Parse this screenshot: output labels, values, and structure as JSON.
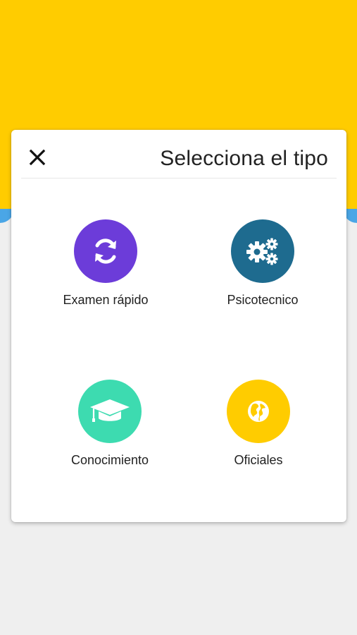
{
  "colors": {
    "background_top": "#ffcc00",
    "background_bottom": "#efefef",
    "accent_blue": "#4aa6e6",
    "quick_exam": "#6c3cd9",
    "psychotechnical": "#1e6b8f",
    "knowledge": "#3ddbb0",
    "official": "#ffcc00"
  },
  "dialog": {
    "title": "Selecciona el tipo",
    "close_icon": "close-icon"
  },
  "options": [
    {
      "label": "Examen rápido",
      "icon": "refresh-icon"
    },
    {
      "label": "Psicotecnico",
      "icon": "gears-icon"
    },
    {
      "label": "Conocimiento",
      "icon": "graduation-cap-icon"
    },
    {
      "label": "Oficiales",
      "icon": "globe-icon"
    }
  ]
}
